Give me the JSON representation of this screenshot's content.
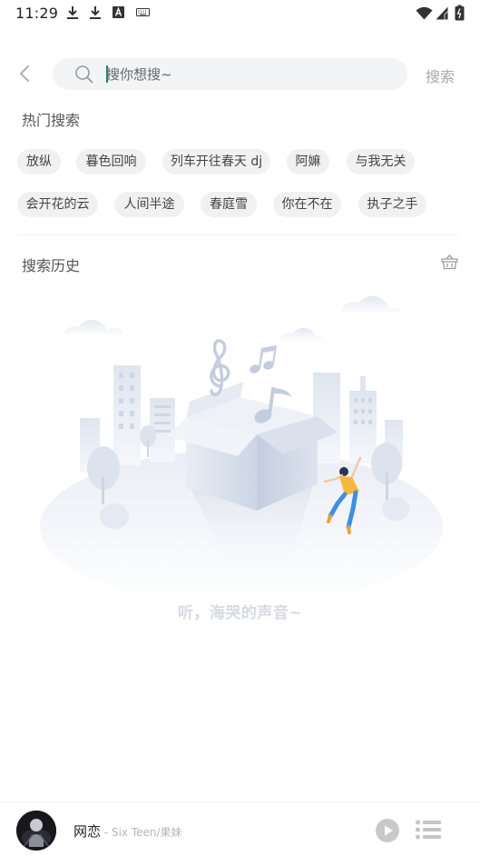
{
  "status_bar": {
    "time": "11:29",
    "icons": [
      "download-icon",
      "download-icon",
      "font-app-icon",
      "keyboard-icon",
      "wifi-icon",
      "signal-icon",
      "battery-icon"
    ]
  },
  "search": {
    "placeholder": "搜你想搜~",
    "button_label": "搜索"
  },
  "hot_search": {
    "title": "热门搜索",
    "tags": [
      "放纵",
      "暮色回响",
      "列车开往春天 dj",
      "阿嫲",
      "与我无关",
      "会开花的云",
      "人间半途",
      "春庭雪",
      "你在不在",
      "执子之手"
    ]
  },
  "history": {
    "title": "搜索历史",
    "clear_icon": "trash-basket-icon",
    "empty_text": "听，海哭的声音~"
  },
  "player": {
    "song": "网恋",
    "artist": " - Six Teen/果妹",
    "icons": [
      "play-icon",
      "playlist-icon"
    ]
  },
  "colors": {
    "caret": "#2e7d6b",
    "search_bg": "#f3f4f6",
    "chip_bg": "#f1f1f1",
    "illustration_blue": "#c9d3e6",
    "dancer_yellow": "#f6b73c",
    "dancer_blue": "#3d8fe0"
  }
}
